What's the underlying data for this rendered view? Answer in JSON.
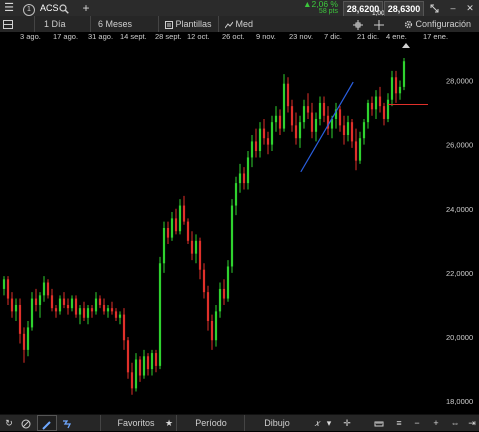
{
  "header": {
    "symbol": "ACS",
    "instance_badge": "1",
    "change_pct": "▲2,06 %",
    "change_pts": "58 pts",
    "sell_price": "28,6200",
    "spread": "1,00",
    "buy_price": "28,6300"
  },
  "toolbar": {
    "interval": "1 Día",
    "range": "6 Meses",
    "templates": "Plantillas",
    "indicator": "Med",
    "config": "Configuración"
  },
  "date_axis": [
    "3 ago.",
    "17 ago.",
    "31 ago.",
    "14 sept.",
    "28 sept.",
    "12 oct.",
    "26 oct.",
    "9 nov.",
    "23 nov.",
    "7 dic.",
    "21 dic.",
    "4 ene.",
    "17 ene."
  ],
  "bottom": {
    "favorites": "Favoritos",
    "period": "Período",
    "drawing": "Dibujo"
  },
  "colors": {
    "up": "#2fd22f",
    "down": "#e0302a",
    "trendline": "#2a5fe0",
    "priceline": "#e0302a",
    "positive_change": "#3cc83c"
  },
  "chart_data": {
    "type": "candlestick",
    "y_ticks": [
      "28,0000",
      "26,0000",
      "24,0000",
      "22,0000",
      "20,0000",
      "18,0000"
    ],
    "ylim": [
      17.6,
      29.2
    ],
    "current_price": 27.25,
    "trendline": {
      "from": [
        0.742,
        25.15
      ],
      "to": [
        0.858,
        27.95
      ]
    },
    "candles": [
      [
        21.5,
        21.9,
        21.3,
        21.8
      ],
      [
        21.8,
        21.9,
        21.0,
        21.2
      ],
      [
        21.2,
        21.4,
        20.6,
        20.8
      ],
      [
        20.8,
        21.2,
        20.5,
        21.0
      ],
      [
        21.0,
        21.2,
        19.8,
        20.1
      ],
      [
        20.1,
        20.3,
        19.2,
        19.6
      ],
      [
        19.6,
        20.5,
        19.4,
        20.3
      ],
      [
        20.3,
        21.4,
        20.2,
        21.2
      ],
      [
        21.2,
        21.5,
        20.8,
        21.0
      ],
      [
        21.0,
        21.4,
        20.6,
        21.3
      ],
      [
        21.3,
        21.9,
        21.1,
        21.7
      ],
      [
        21.7,
        21.8,
        21.2,
        21.3
      ],
      [
        21.3,
        21.5,
        20.8,
        20.9
      ],
      [
        20.9,
        21.0,
        20.6,
        20.8
      ],
      [
        20.8,
        21.3,
        20.7,
        21.2
      ],
      [
        21.2,
        21.4,
        20.9,
        21.0
      ],
      [
        21.0,
        21.2,
        20.7,
        20.9
      ],
      [
        20.9,
        21.3,
        20.8,
        21.2
      ],
      [
        21.2,
        21.3,
        20.6,
        20.7
      ],
      [
        20.7,
        21.0,
        20.4,
        20.9
      ],
      [
        20.9,
        21.1,
        20.5,
        20.6
      ],
      [
        20.6,
        21.0,
        20.4,
        20.9
      ],
      [
        20.9,
        21.0,
        20.6,
        20.8
      ],
      [
        20.8,
        21.4,
        20.7,
        21.2
      ],
      [
        21.2,
        21.3,
        20.9,
        21.0
      ],
      [
        21.0,
        21.2,
        20.7,
        20.8
      ],
      [
        20.8,
        21.0,
        20.6,
        20.9
      ],
      [
        20.9,
        21.1,
        20.7,
        20.8
      ],
      [
        20.8,
        20.9,
        20.5,
        20.6
      ],
      [
        20.6,
        20.8,
        20.4,
        20.7
      ],
      [
        20.7,
        20.9,
        19.6,
        19.9
      ],
      [
        19.9,
        20.0,
        18.7,
        18.9
      ],
      [
        18.9,
        19.2,
        18.2,
        18.4
      ],
      [
        18.4,
        19.5,
        18.3,
        19.3
      ],
      [
        19.3,
        19.4,
        18.6,
        18.8
      ],
      [
        18.8,
        19.6,
        18.7,
        19.4
      ],
      [
        19.4,
        19.5,
        18.8,
        19.0
      ],
      [
        19.0,
        19.6,
        18.8,
        19.5
      ],
      [
        19.5,
        19.6,
        18.9,
        19.1
      ],
      [
        19.1,
        22.5,
        19.0,
        22.3
      ],
      [
        22.3,
        23.6,
        22.0,
        23.4
      ],
      [
        23.4,
        23.6,
        22.9,
        23.1
      ],
      [
        23.1,
        23.9,
        23.0,
        23.7
      ],
      [
        23.7,
        24.0,
        23.2,
        23.3
      ],
      [
        23.3,
        24.3,
        23.2,
        24.1
      ],
      [
        24.1,
        24.4,
        23.5,
        23.6
      ],
      [
        23.6,
        23.7,
        22.9,
        23.0
      ],
      [
        23.0,
        23.3,
        22.4,
        22.6
      ],
      [
        22.6,
        23.2,
        22.3,
        23.0
      ],
      [
        23.0,
        23.1,
        21.8,
        22.1
      ],
      [
        22.1,
        22.3,
        21.2,
        21.4
      ],
      [
        21.4,
        21.6,
        20.2,
        20.5
      ],
      [
        20.5,
        20.7,
        19.6,
        19.9
      ],
      [
        19.9,
        21.0,
        19.7,
        20.8
      ],
      [
        20.8,
        21.7,
        20.6,
        21.5
      ],
      [
        21.5,
        21.8,
        21.0,
        21.2
      ],
      [
        21.2,
        22.4,
        21.1,
        22.2
      ],
      [
        22.2,
        24.3,
        22.0,
        24.1
      ],
      [
        24.1,
        25.0,
        23.8,
        24.8
      ],
      [
        24.8,
        25.4,
        24.5,
        25.1
      ],
      [
        25.1,
        25.3,
        24.6,
        24.8
      ],
      [
        24.8,
        25.8,
        24.6,
        25.6
      ],
      [
        25.6,
        26.3,
        25.3,
        26.1
      ],
      [
        26.1,
        26.5,
        25.6,
        25.8
      ],
      [
        25.8,
        26.7,
        25.6,
        26.5
      ],
      [
        26.5,
        26.8,
        26.0,
        26.2
      ],
      [
        26.2,
        26.4,
        25.7,
        26.0
      ],
      [
        26.0,
        26.9,
        25.8,
        26.7
      ],
      [
        26.7,
        27.2,
        26.4,
        26.9
      ],
      [
        26.9,
        27.1,
        26.3,
        26.5
      ],
      [
        26.5,
        28.2,
        26.4,
        27.9
      ],
      [
        27.9,
        28.1,
        27.0,
        27.2
      ],
      [
        27.2,
        27.4,
        26.4,
        26.6
      ],
      [
        26.6,
        27.0,
        26.0,
        26.2
      ],
      [
        26.2,
        26.9,
        25.9,
        26.7
      ],
      [
        26.7,
        27.4,
        26.5,
        27.2
      ],
      [
        27.2,
        27.6,
        26.8,
        27.0
      ],
      [
        27.0,
        27.3,
        26.2,
        26.4
      ],
      [
        26.4,
        27.0,
        26.1,
        26.8
      ],
      [
        26.8,
        27.5,
        26.6,
        27.3
      ],
      [
        27.3,
        27.5,
        26.7,
        26.9
      ],
      [
        26.9,
        27.2,
        26.3,
        26.5
      ],
      [
        26.5,
        26.9,
        26.2,
        26.8
      ],
      [
        26.8,
        27.3,
        26.5,
        27.1
      ],
      [
        27.1,
        27.2,
        26.4,
        26.6
      ],
      [
        26.6,
        26.9,
        26.0,
        26.3
      ],
      [
        26.3,
        26.9,
        26.1,
        26.7
      ],
      [
        26.7,
        26.8,
        25.9,
        26.1
      ],
      [
        26.1,
        26.5,
        25.2,
        25.5
      ],
      [
        25.5,
        26.4,
        25.4,
        26.2
      ],
      [
        26.2,
        26.8,
        26.0,
        26.7
      ],
      [
        26.7,
        27.4,
        26.5,
        27.3
      ],
      [
        27.3,
        27.5,
        26.9,
        27.1
      ],
      [
        27.1,
        27.7,
        26.8,
        27.5
      ],
      [
        27.5,
        27.8,
        27.0,
        27.2
      ],
      [
        27.2,
        27.3,
        26.6,
        26.8
      ],
      [
        26.8,
        27.6,
        26.7,
        27.4
      ],
      [
        27.4,
        28.3,
        27.2,
        28.1
      ],
      [
        28.1,
        28.3,
        27.3,
        27.6
      ],
      [
        27.6,
        28.0,
        27.4,
        27.8
      ],
      [
        27.8,
        28.7,
        27.7,
        28.6
      ]
    ]
  }
}
